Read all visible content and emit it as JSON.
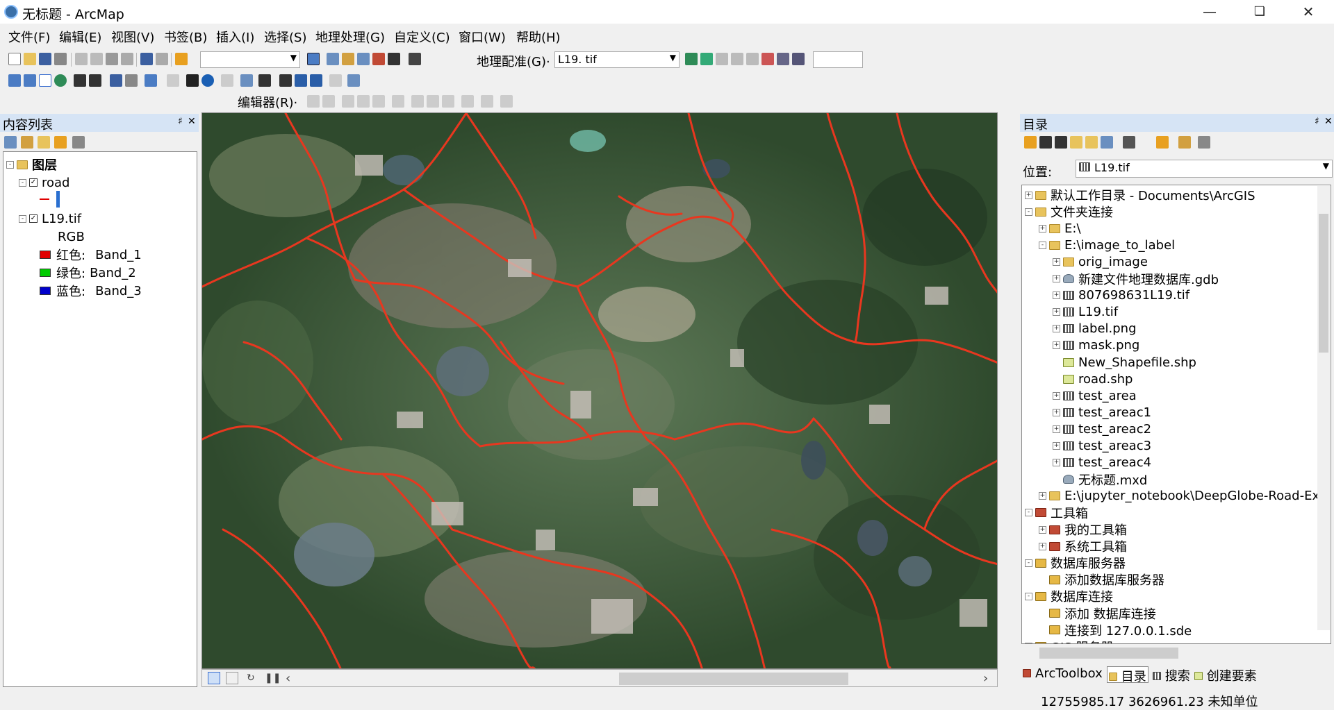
{
  "window": {
    "title": "无标题 - ArcMap"
  },
  "menu": [
    "文件(F)",
    "编辑(E)",
    "视图(V)",
    "书签(B)",
    "插入(I)",
    "选择(S)",
    "地理处理(G)",
    "自定义(C)",
    "窗口(W)",
    "帮助(H)"
  ],
  "toolbar": {
    "georef_label": "地理配准(G)·",
    "georef_layer": "L19. tif",
    "editor_label": "编辑器(R)·"
  },
  "toc": {
    "title": "内容列表",
    "root": "图层",
    "layers": [
      {
        "name": "road"
      },
      {
        "name": "L19.tif",
        "sub": "RGB",
        "bands": [
          {
            "label": "红色:",
            "value": "Band_1",
            "color": "#e00000"
          },
          {
            "label": "绿色:",
            "value": "Band_2",
            "color": "#00cc00"
          },
          {
            "label": "蓝色:",
            "value": "Band_3",
            "color": "#0000cc"
          }
        ]
      }
    ]
  },
  "catalog": {
    "title": "目录",
    "location_label": "位置:",
    "location_value": "L19.tif",
    "tree": [
      {
        "text": "默认工作目录 - Documents\\ArcGIS",
        "level": 0,
        "exp": "+",
        "icon": "folder"
      },
      {
        "text": "文件夹连接",
        "level": 0,
        "exp": "-",
        "icon": "folder"
      },
      {
        "text": "E:\\",
        "level": 1,
        "exp": "+",
        "icon": "folder"
      },
      {
        "text": "E:\\image_to_label",
        "level": 1,
        "exp": "-",
        "icon": "folder"
      },
      {
        "text": "orig_image",
        "level": 2,
        "exp": "+",
        "icon": "folder"
      },
      {
        "text": "新建文件地理数据库.gdb",
        "level": 2,
        "exp": "+",
        "icon": "gdb"
      },
      {
        "text": "807698631L19.tif",
        "level": 2,
        "exp": "+",
        "icon": "raster"
      },
      {
        "text": "L19.tif",
        "level": 2,
        "exp": "+",
        "icon": "raster"
      },
      {
        "text": "label.png",
        "level": 2,
        "exp": "+",
        "icon": "raster"
      },
      {
        "text": "mask.png",
        "level": 2,
        "exp": "+",
        "icon": "raster"
      },
      {
        "text": "New_Shapefile.shp",
        "level": 2,
        "exp": "",
        "icon": "shp"
      },
      {
        "text": "road.shp",
        "level": 2,
        "exp": "",
        "icon": "shp"
      },
      {
        "text": "test_area",
        "level": 2,
        "exp": "+",
        "icon": "raster"
      },
      {
        "text": "test_areac1",
        "level": 2,
        "exp": "+",
        "icon": "raster"
      },
      {
        "text": "test_areac2",
        "level": 2,
        "exp": "+",
        "icon": "raster"
      },
      {
        "text": "test_areac3",
        "level": 2,
        "exp": "+",
        "icon": "raster"
      },
      {
        "text": "test_areac4",
        "level": 2,
        "exp": "+",
        "icon": "raster"
      },
      {
        "text": "无标题.mxd",
        "level": 2,
        "exp": "",
        "icon": "gdb"
      },
      {
        "text": "E:\\jupyter_notebook\\DeepGlobe-Road-Ext",
        "level": 1,
        "exp": "+",
        "icon": "folder"
      },
      {
        "text": "工具箱",
        "level": 0,
        "exp": "-",
        "icon": "toolbox"
      },
      {
        "text": "我的工具箱",
        "level": 1,
        "exp": "+",
        "icon": "toolbox"
      },
      {
        "text": "系统工具箱",
        "level": 1,
        "exp": "+",
        "icon": "toolbox"
      },
      {
        "text": "数据库服务器",
        "level": 0,
        "exp": "-",
        "icon": "db"
      },
      {
        "text": "添加数据库服务器",
        "level": 1,
        "exp": "",
        "icon": "db"
      },
      {
        "text": "数据库连接",
        "level": 0,
        "exp": "-",
        "icon": "db"
      },
      {
        "text": "添加 数据库连接",
        "level": 1,
        "exp": "",
        "icon": "db"
      },
      {
        "text": "连接到 127.0.0.1.sde",
        "level": 1,
        "exp": "",
        "icon": "db"
      },
      {
        "text": "GIS 服务器",
        "level": 0,
        "exp": "-",
        "icon": "db"
      }
    ]
  },
  "bottom_tabs": [
    "ArcToolbox",
    "目录",
    "搜索",
    "创建要素"
  ],
  "status": {
    "coords": "12755985.17  3626961.23 未知单位"
  }
}
